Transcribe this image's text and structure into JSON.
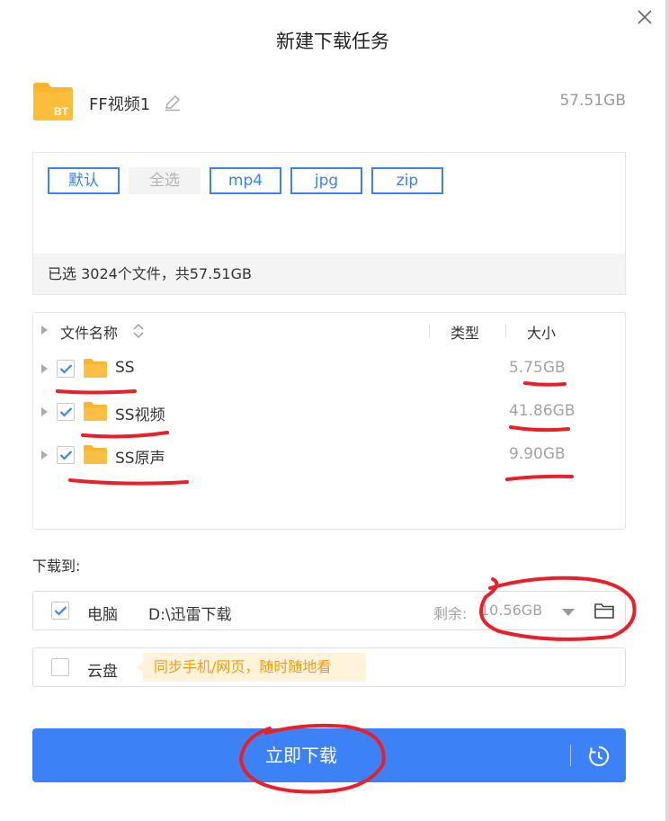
{
  "dialog": {
    "title": "新建下载任务",
    "close_icon": "close-icon"
  },
  "task": {
    "icon": "bt-file-icon",
    "icon_badge": "BT",
    "name": "FF视频1",
    "edit_icon": "pencil-icon",
    "total_size": "57.51GB"
  },
  "filters": {
    "tags": [
      {
        "label": "默认",
        "state": "active"
      },
      {
        "label": "全选",
        "state": "disabled"
      },
      {
        "label": "mp4",
        "state": "active"
      },
      {
        "label": "jpg",
        "state": "active"
      },
      {
        "label": "zip",
        "state": "active"
      }
    ],
    "summary": "已选 3024个文件，共57.51GB"
  },
  "file_list": {
    "columns": {
      "name": "文件名称",
      "type": "类型",
      "size": "大小"
    },
    "sort_icon": "sort-updown-icon",
    "rows": [
      {
        "name": "SS",
        "type": "",
        "size": "5.75GB",
        "checked": true,
        "icon": "folder-icon"
      },
      {
        "name": "SS视频",
        "type": "",
        "size": "41.86GB",
        "checked": true,
        "icon": "folder-icon"
      },
      {
        "name": "SS原声",
        "type": "",
        "size": "9.90GB",
        "checked": true,
        "icon": "folder-icon"
      }
    ]
  },
  "destination": {
    "label": "下载到:",
    "local": {
      "checked": true,
      "label": "电脑",
      "path": "D:\\迅雷下载",
      "remaining_label": "剩余:",
      "remaining_value": "10.56GB",
      "dropdown_icon": "caret-down-icon",
      "browse_icon": "open-folder-icon"
    },
    "cloud": {
      "checked": false,
      "label": "云盘",
      "tip": "同步手机/网页，随时随地看"
    }
  },
  "actions": {
    "download_label": "立即下载",
    "schedule_icon": "clock-icon"
  },
  "colors": {
    "accent": "#3c82f6",
    "folder": "#f9b52d",
    "tip_bg": "#fff3dc",
    "tip_text": "#f39c12",
    "annotation": "#e8202a"
  }
}
